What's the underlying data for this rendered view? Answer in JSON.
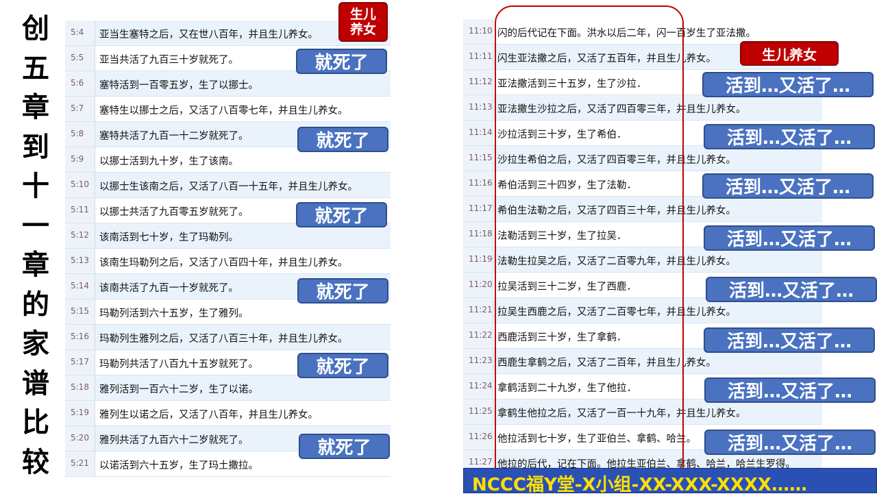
{
  "title_chars": [
    "创",
    "五",
    "章",
    "到",
    "十",
    "一",
    "章",
    "的",
    "家",
    "谱",
    "比",
    "较"
  ],
  "left_verses": [
    {
      "ref": "5:4",
      "text": "亚当生塞特之后，又在世八百年，并且生儿养女。"
    },
    {
      "ref": "5:5",
      "text": "亚当共活了九百三十岁就死了。"
    },
    {
      "ref": "5:6",
      "text": "塞特活到一百零五岁，生了以挪士。"
    },
    {
      "ref": "5:7",
      "text": "塞特生以挪士之后，又活了八百零七年，并且生儿养女。"
    },
    {
      "ref": "5:8",
      "text": "塞特共活了九百一十二岁就死了。"
    },
    {
      "ref": "5:9",
      "text": "以挪士活到九十岁，生了该南。"
    },
    {
      "ref": "5:10",
      "text": "以挪士生该南之后，又活了八百一十五年，并且生儿养女。"
    },
    {
      "ref": "5:11",
      "text": "以挪士共活了九百零五岁就死了。"
    },
    {
      "ref": "5:12",
      "text": "该南活到七十岁，生了玛勒列。"
    },
    {
      "ref": "5:13",
      "text": "该南生玛勒列之后，又活了八百四十年，并且生儿养女。"
    },
    {
      "ref": "5:14",
      "text": "该南共活了九百一十岁就死了。"
    },
    {
      "ref": "5:15",
      "text": "玛勒列活到六十五岁，生了雅列。"
    },
    {
      "ref": "5:16",
      "text": "玛勒列生雅列之后，又活了八百三十年，并且生儿养女。"
    },
    {
      "ref": "5:17",
      "text": "玛勒列共活了八百九十五岁就死了。"
    },
    {
      "ref": "5:18",
      "text": "雅列活到一百六十二岁，生了以诺。"
    },
    {
      "ref": "5:19",
      "text": "雅列生以诺之后，又活了八百年，并且生儿养女。"
    },
    {
      "ref": "5:20",
      "text": "雅列共活了九百六十二岁就死了。"
    },
    {
      "ref": "5:21",
      "text": "以诺活到六十五岁，生了玛土撒拉。"
    }
  ],
  "right_verses": [
    {
      "ref": "11:10",
      "text": "闪的后代记在下面。洪水以后二年，闪一百岁生了亚法撒。"
    },
    {
      "ref": "11:11",
      "text": "闪生亚法撒之后，又活了五百年，并且生儿养女。"
    },
    {
      "ref": "11:12",
      "text": "亚法撒活到三十五岁，生了沙拉．"
    },
    {
      "ref": "11:13",
      "text": "亚法撒生沙拉之后，又活了四百零三年，并且生儿养女。"
    },
    {
      "ref": "11:14",
      "text": "沙拉活到三十岁，生了希伯．"
    },
    {
      "ref": "11:15",
      "text": "沙拉生希伯之后，又活了四百零三年，并且生儿养女。"
    },
    {
      "ref": "11:16",
      "text": "希伯活到三十四岁，生了法勒．"
    },
    {
      "ref": "11:17",
      "text": "希伯生法勒之后，又活了四百三十年，并且生儿养女。"
    },
    {
      "ref": "11:18",
      "text": "法勒活到三十岁，生了拉吴．"
    },
    {
      "ref": "11:19",
      "text": "法勒生拉吴之后，又活了二百零九年，并且生儿养女。"
    },
    {
      "ref": "11:20",
      "text": "拉吴活到三十二岁，生了西鹿．"
    },
    {
      "ref": "11:21",
      "text": "拉吴生西鹿之后，又活了二百零七年，并且生儿养女。"
    },
    {
      "ref": "11:22",
      "text": "西鹿活到三十岁，生了拿鹤．"
    },
    {
      "ref": "11:23",
      "text": "西鹿生拿鹤之后，又活了二百年，并且生儿养女。"
    },
    {
      "ref": "11:24",
      "text": "拿鹤活到二十九岁，生了他拉．"
    },
    {
      "ref": "11:25",
      "text": "拿鹤生他拉之后，又活了一百一十九年，并且生儿养女。"
    },
    {
      "ref": "11:26",
      "text": "他拉活到七十岁，生了亚伯兰、拿鹤、哈兰。"
    },
    {
      "ref": "11:27",
      "text": "他拉的后代，记在下面。他拉生亚伯兰、拿鹤、哈兰，哈兰生罗得。"
    }
  ],
  "badges": {
    "died": "就死了",
    "lived_again": "活到…又活了…",
    "children_stacked_1": "生儿",
    "children_stacked_2": "养女",
    "children": "生儿养女"
  },
  "footer": "NCCC福Y堂-X小组-XX-XXX-XXXX……",
  "colors": {
    "badge_blue": "#4a72c0",
    "badge_red": "#c00000",
    "highlight_frame": "#c00000",
    "footer_bg": "#2b50b4",
    "footer_text": "#ffe000",
    "row_alt_bg": "#eaf3fc"
  }
}
